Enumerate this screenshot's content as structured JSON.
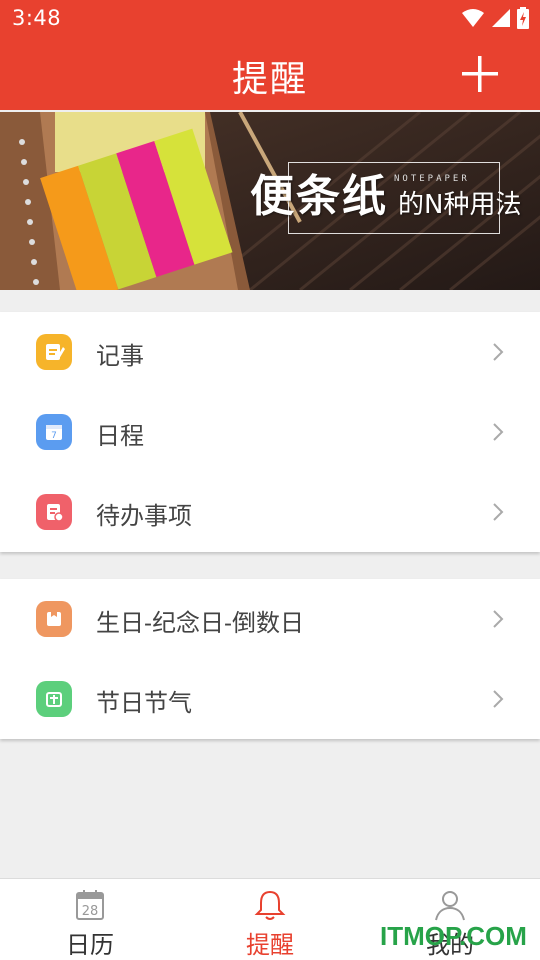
{
  "status_bar": {
    "time": "3:48"
  },
  "app_bar": {
    "title": "提醒"
  },
  "banner": {
    "headline": "便条纸",
    "subline": "的N种用法",
    "tag": "NOTEPAPER"
  },
  "card1": {
    "items": [
      {
        "label": "记事",
        "icon": "note-icon",
        "color": "#f6b42a"
      },
      {
        "label": "日程",
        "icon": "calendar-icon",
        "color": "#5b9cf0"
      },
      {
        "label": "待办事项",
        "icon": "todo-icon",
        "color": "#f0616a"
      }
    ]
  },
  "card2": {
    "items": [
      {
        "label": "生日-纪念日-倒数日",
        "icon": "gift-icon",
        "color": "#ef9760"
      },
      {
        "label": "节日节气",
        "icon": "festival-icon",
        "color": "#5ccf7c"
      }
    ]
  },
  "tab_bar": {
    "tabs": [
      {
        "label": "日历",
        "icon": "calendar-tab-icon",
        "day": "28"
      },
      {
        "label": "提醒",
        "icon": "bell-icon"
      },
      {
        "label": "我的",
        "icon": "person-icon"
      }
    ],
    "active_tab": "提醒"
  },
  "watermark": "ITMOP.COM",
  "colors": {
    "accent": "#e8412f",
    "background": "#efefef"
  }
}
